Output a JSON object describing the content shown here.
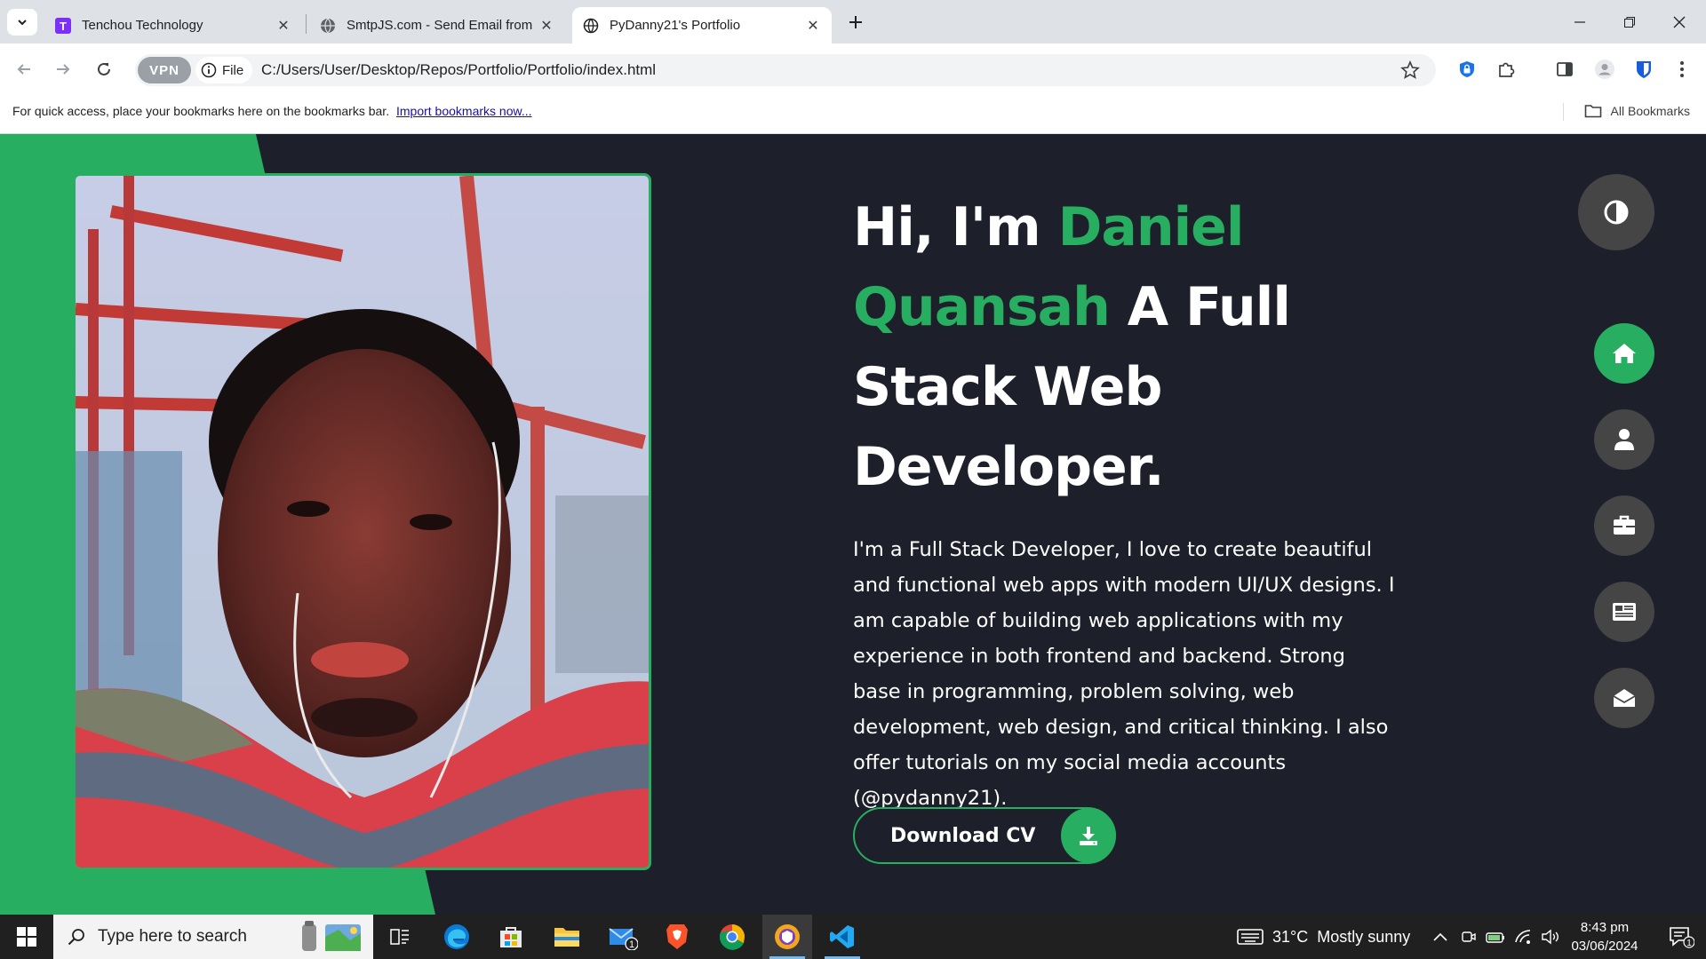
{
  "browser": {
    "tabs": [
      {
        "title": "Tenchou Technology",
        "active": false
      },
      {
        "title": "SmtpJS.com - Send Email from",
        "active": false
      },
      {
        "title": "PyDanny21's Portfolio",
        "active": true
      }
    ],
    "vpn_label": "VPN",
    "file_label": "File",
    "url": "C:/Users/User/Desktop/Repos/Portfolio/Portfolio/index.html",
    "bookmarks_bar": {
      "prompt": "For quick access, place your bookmarks here on the bookmarks bar.",
      "import_link": "Import bookmarks now...",
      "all_bookmarks": "All Bookmarks"
    }
  },
  "hero": {
    "greeting": "Hi, I'm ",
    "name": "Daniel Quansah",
    "role": " A Full Stack Web Developer.",
    "description": "I'm a Full Stack Developer, I love to create beautiful and functional web apps with modern UI/UX designs. I am capable of building web applications with my experience in both frontend and backend. Strong base in programming, problem solving, web development, web design, and critical thinking. I also offer tutorials on my social media accounts (@pydanny21).",
    "cv_button": "Download CV"
  },
  "side_nav": {
    "items": [
      "home-icon",
      "user-icon",
      "briefcase-icon",
      "newspaper-icon",
      "envelope-open-icon"
    ],
    "active": 0
  },
  "taskbar": {
    "search_placeholder": "Type here to search",
    "weather": "31°C  Mostly sunny",
    "time": "8:43 pm",
    "date": "03/06/2024",
    "mail_badge": "1",
    "notification_badge": "1"
  },
  "colors": {
    "accent": "#27ae60",
    "page_bg": "#1d1f2b",
    "nav_button": "#454545"
  }
}
